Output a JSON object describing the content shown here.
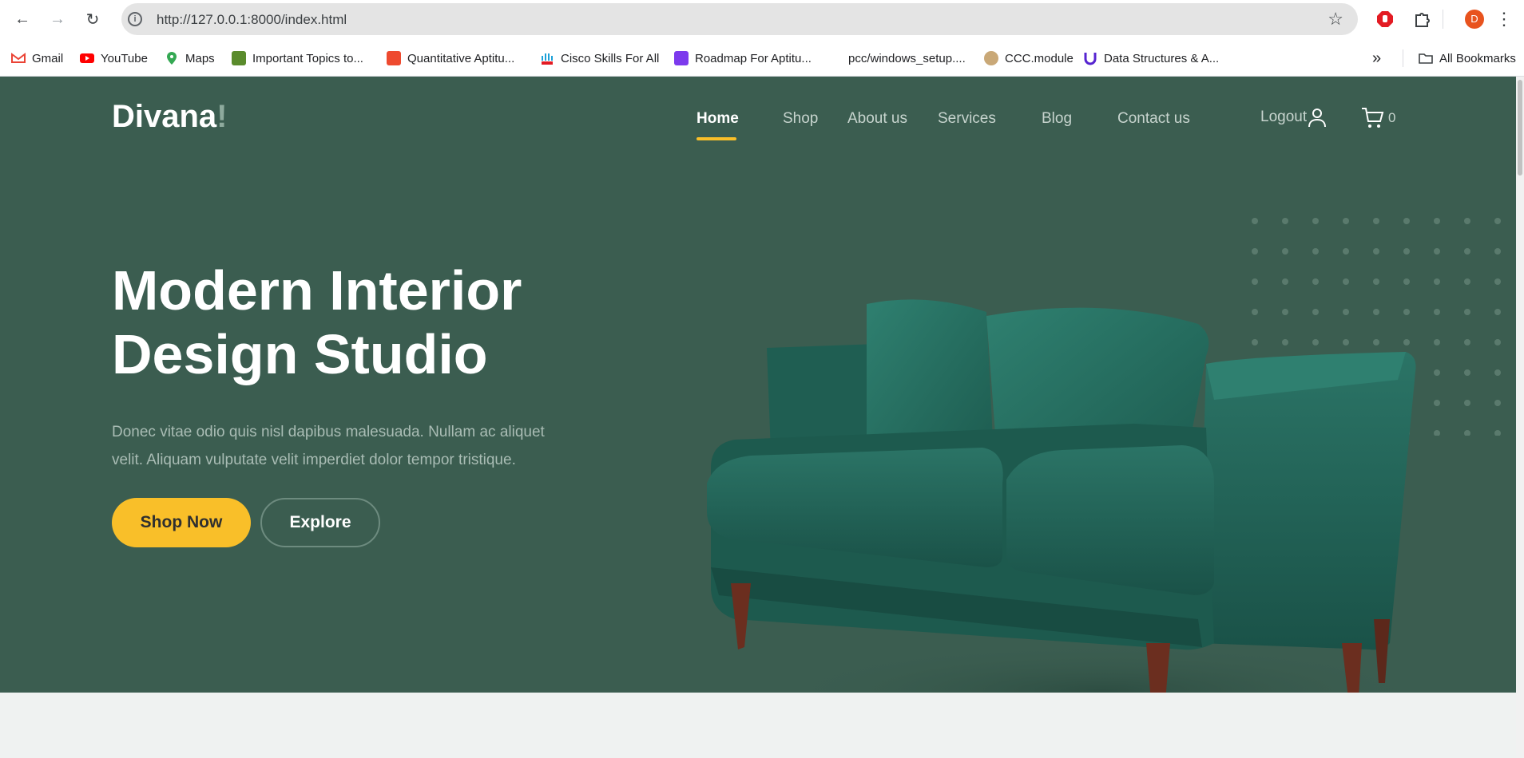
{
  "browser": {
    "url": "http://127.0.0.1:8000/index.html",
    "profile_initial": "D",
    "bookmarks": [
      {
        "label": "Gmail",
        "icon": "gmail-icon"
      },
      {
        "label": "YouTube",
        "icon": "youtube-icon"
      },
      {
        "label": "Maps",
        "icon": "maps-icon"
      },
      {
        "label": "Important Topics to...",
        "icon": "bookmark-icon"
      },
      {
        "label": "Quantitative Aptitu...",
        "icon": "bookmark-icon"
      },
      {
        "label": "Cisco Skills For All",
        "icon": "cisco-icon"
      },
      {
        "label": "Roadmap For Aptitu...",
        "icon": "bookmark-icon"
      },
      {
        "label": "pcc/windows_setup....",
        "icon": ""
      },
      {
        "label": "CCC.module",
        "icon": "bookmark-icon"
      },
      {
        "label": "Data Structures & A...",
        "icon": "udemy-icon"
      }
    ],
    "more_bookmarks": "»",
    "all_bookmarks": "All Bookmarks"
  },
  "site": {
    "logo_text": "Divana",
    "logo_bang": "!",
    "nav": [
      "Home",
      "Shop",
      "About us",
      "Services",
      "Blog",
      "Contact us"
    ],
    "active_nav": "Home",
    "logout": "Logout",
    "cart_count": "0",
    "accent": "#f9bf29",
    "hero_bg": "#3b5d50"
  },
  "hero": {
    "title_line1": "Modern Interior",
    "title_line2": "Design Studio",
    "lead_line1": "Donec vitae odio quis nisl dapibus malesuada. Nullam ac aliquet",
    "lead_line2": "velit. Aliquam vulputate velit imperdiet dolor tempor tristique.",
    "primary_button": "Shop Now",
    "secondary_button": "Explore"
  }
}
